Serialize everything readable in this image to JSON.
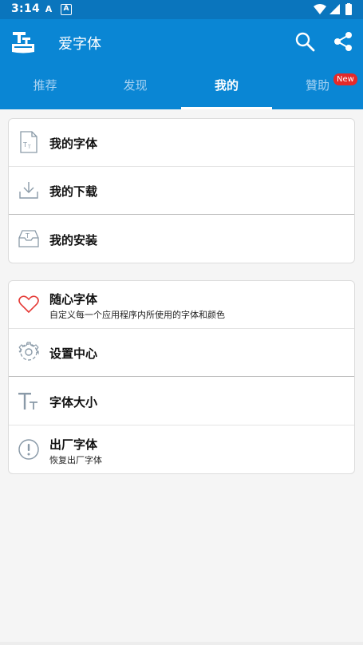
{
  "status_bar": {
    "time": "3:14",
    "left_icons": [
      "font-a-icon",
      "a-box-icon"
    ],
    "right_icons": [
      "wifi-icon",
      "signal-icon",
      "battery-icon"
    ]
  },
  "app_bar": {
    "title": "爱字体",
    "logo_icon": "typeface-logo-icon",
    "actions": [
      "search-icon",
      "share-icon"
    ],
    "background": "#0a86d4"
  },
  "tabs": {
    "items": [
      {
        "label": "推荐"
      },
      {
        "label": "发现"
      },
      {
        "label": "我的"
      },
      {
        "label": "贊助"
      }
    ],
    "active_index": 2,
    "badge": "New",
    "badge_color": "#e52929"
  },
  "menu_group_1": [
    {
      "title": "我的字体",
      "icon": "font-document-icon"
    },
    {
      "title": "我的下载",
      "icon": "download-icon"
    },
    {
      "title": "我的安装",
      "icon": "install-tray-icon"
    }
  ],
  "menu_group_2": [
    {
      "title": "随心字体",
      "subtitle": "自定义每一个应用程序内所使用的字体和颜色",
      "icon": "heart-icon"
    },
    {
      "title": "设置中心",
      "icon": "gear-icon"
    },
    {
      "title": "字体大小",
      "icon": "font-size-icon"
    },
    {
      "title": "出厂字体",
      "subtitle": "恢复出厂字体",
      "icon": "exclamation-circle-icon"
    }
  ],
  "colors": {
    "primary": "#0a86d4",
    "status_bar": "#0a75bd",
    "heart": "#e53935",
    "icon_gray": "#8a9aa8"
  }
}
